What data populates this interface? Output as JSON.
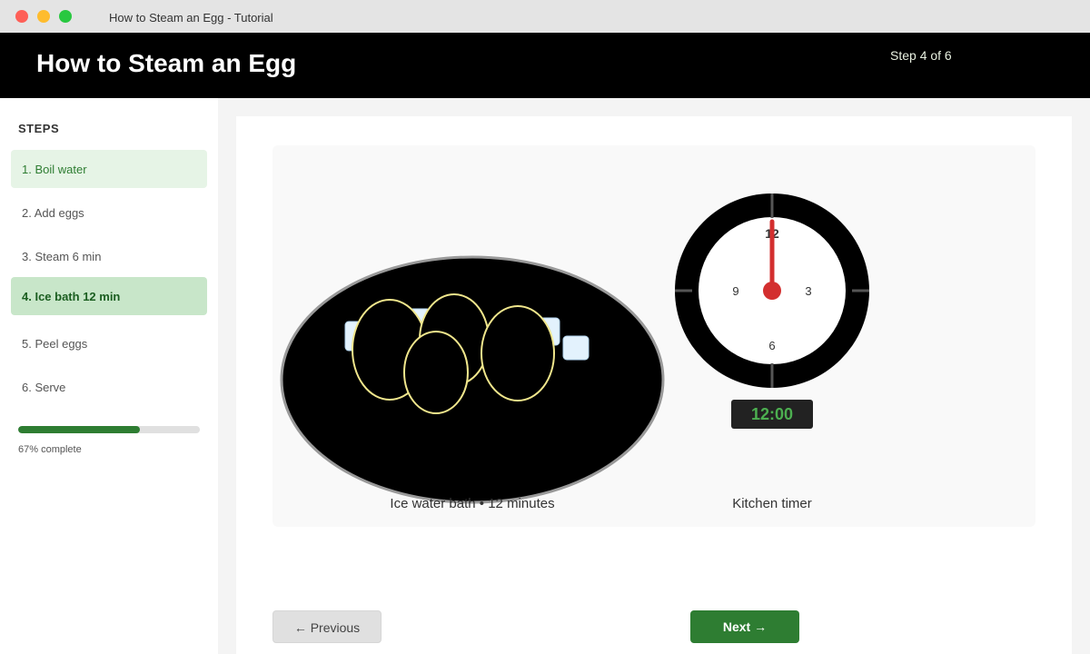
{
  "window": {
    "title": "How to Steam an Egg - Tutorial"
  },
  "header": {
    "title": "How to Steam an Egg",
    "step_indicator": "Step 4 of 6"
  },
  "sidebar": {
    "heading": "STEPS",
    "steps": [
      {
        "label": "1. Boil water",
        "state": "done"
      },
      {
        "label": "2. Add eggs",
        "state": "pending"
      },
      {
        "label": "3. Steam 6 min",
        "state": "pending"
      },
      {
        "label": "4. Ice bath 12 min",
        "state": "current"
      },
      {
        "label": "5. Peel eggs",
        "state": "pending"
      },
      {
        "label": "6. Serve",
        "state": "pending"
      }
    ],
    "progress": {
      "fraction": 0.67,
      "label": "67% complete"
    }
  },
  "illustration": {
    "bowl_caption": "Ice water bath • 12 minutes",
    "timer_caption": "Kitchen timer",
    "clock_numbers": {
      "twelve": "12",
      "three": "3",
      "six": "6",
      "nine": "9"
    },
    "timer_display": "12:00"
  },
  "nav": {
    "previous_label": "← Previous",
    "next_label": "Next →"
  },
  "colors": {
    "accent": "#2e7d32",
    "header_bg": "#000000",
    "clock_hand": "#d32f2f",
    "timer_text": "#4caf50"
  }
}
